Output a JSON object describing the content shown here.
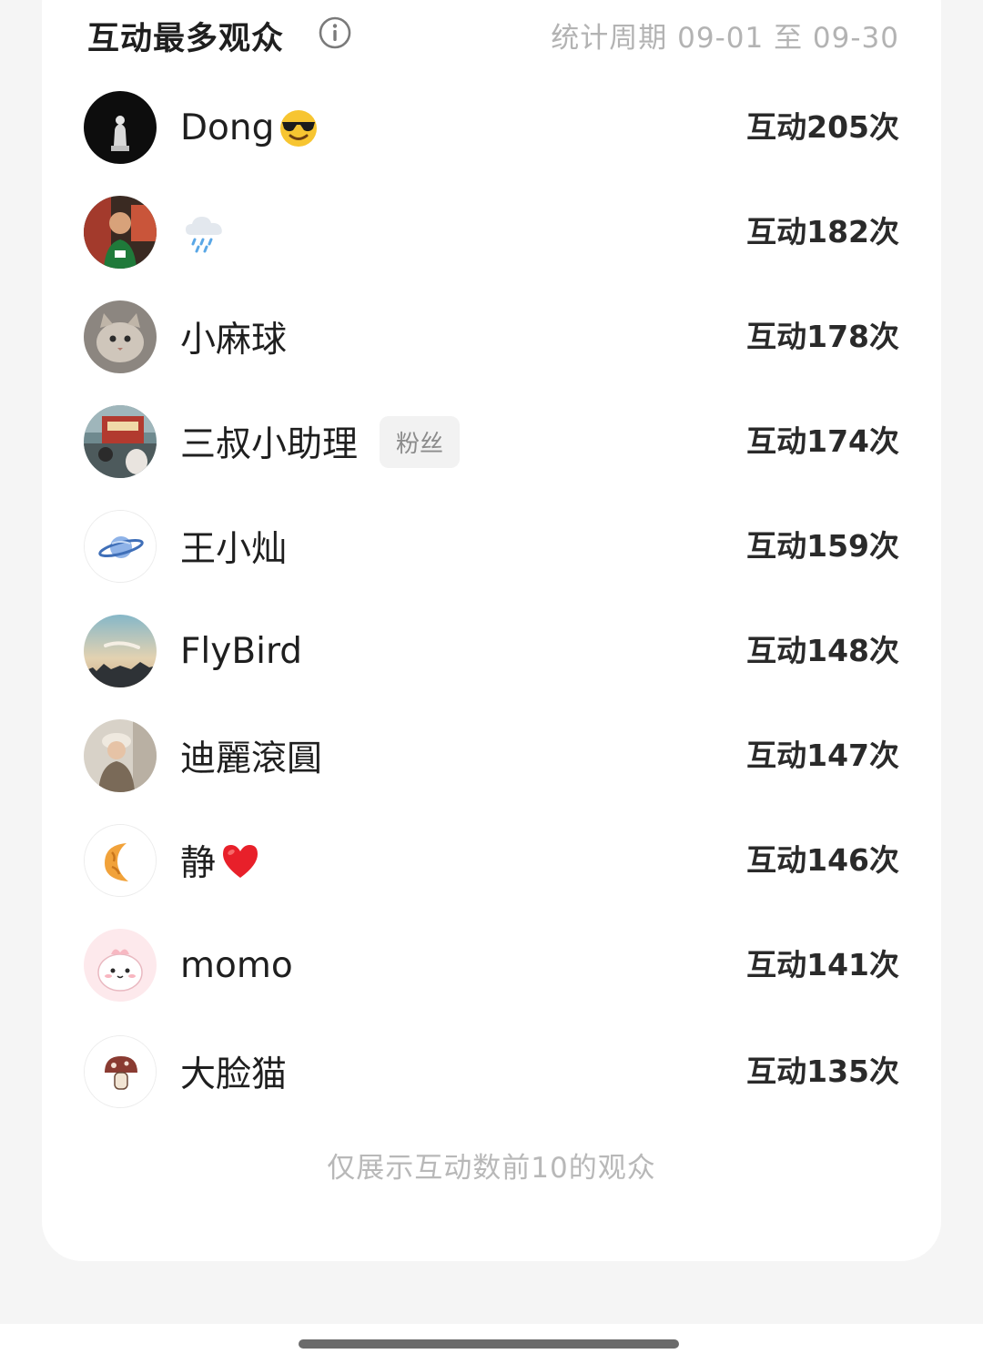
{
  "header": {
    "title": "互动最多观众",
    "period": "统计周期 09-01 至 09-30"
  },
  "audience": [
    {
      "name": "Dong",
      "emoji": "sunglasses-face-emoji",
      "badge": "",
      "count": "互动205次"
    },
    {
      "name": "",
      "emoji": "rain-cloud-emoji",
      "badge": "",
      "count": "互动182次"
    },
    {
      "name": "小麻球",
      "emoji": "",
      "badge": "",
      "count": "互动178次"
    },
    {
      "name": "三叔小助理",
      "emoji": "",
      "badge": "粉丝",
      "count": "互动174次"
    },
    {
      "name": "王小灿",
      "emoji": "",
      "badge": "",
      "count": "互动159次"
    },
    {
      "name": "FlyBird",
      "emoji": "",
      "badge": "",
      "count": "互动148次"
    },
    {
      "name": "迪麗滾圓",
      "emoji": "",
      "badge": "",
      "count": "互动147次"
    },
    {
      "name": "静",
      "emoji": "red-heart-emoji",
      "badge": "",
      "count": "互动146次"
    },
    {
      "name": "momo",
      "emoji": "",
      "badge": "",
      "count": "互动141次"
    },
    {
      "name": "大脸猫",
      "emoji": "",
      "badge": "",
      "count": "互动135次"
    }
  ],
  "footer_note": "仅展示互动数前10的观众",
  "colors": {
    "page_bg": "#f5f5f5",
    "card_bg": "#ffffff",
    "muted_text": "#b3b3b3",
    "badge_bg": "#f2f2f2"
  }
}
